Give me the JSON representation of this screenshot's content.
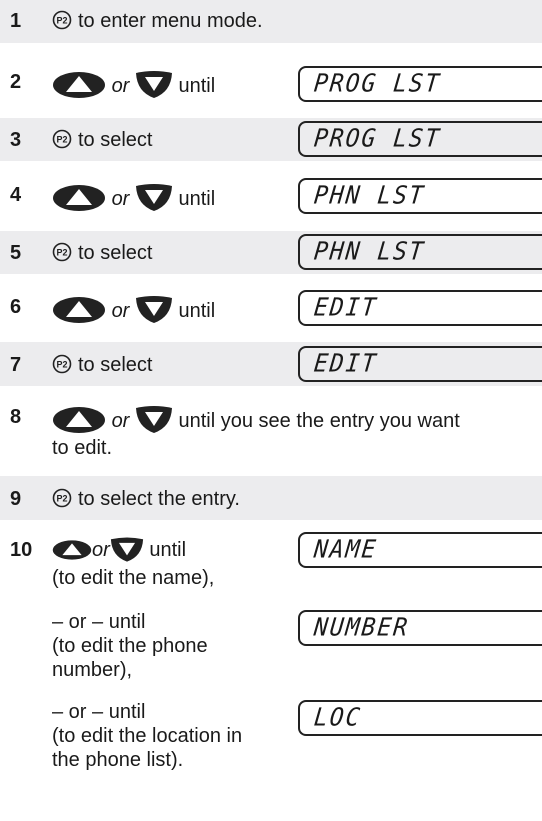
{
  "steps": [
    {
      "num": "1",
      "icons": [
        "p2"
      ],
      "before": "",
      "after": "to enter menu mode.",
      "lcd": ""
    },
    {
      "num": "2",
      "text_mid": "or",
      "after": "until",
      "lcd": "PROG LST"
    },
    {
      "num": "3",
      "after": "to select",
      "lcd": "PROG LST"
    },
    {
      "num": "4",
      "text_mid": "or",
      "after": "until",
      "lcd": "PHN LST"
    },
    {
      "num": "5",
      "after": "to select",
      "lcd": "PHN LST"
    },
    {
      "num": "6",
      "text_mid": "or",
      "after": "until",
      "lcd": "EDIT"
    },
    {
      "num": "7",
      "after": "to select",
      "lcd": "EDIT"
    },
    {
      "num": "8",
      "text_mid": "or",
      "after_line1": "until you see the entry you want",
      "after_line2": "to edit."
    },
    {
      "num": "9",
      "after": "to select the entry."
    },
    {
      "num": "10",
      "text_mid": "or",
      "after": "until",
      "line2": "(to edit the name),",
      "lcd": "NAME",
      "alt1_line1": "– or – until",
      "alt1_line2": "(to edit the phone",
      "alt1_line3": "number),",
      "alt1_lcd": "NUMBER",
      "alt2_line1": "– or –  until",
      "alt2_line2": "(to edit the location in",
      "alt2_line3": "the phone list).",
      "alt2_lcd": "LOC"
    }
  ],
  "colors": {
    "shade": "#ececee",
    "text": "#1a1a1a",
    "button": "#222222"
  },
  "icons": {
    "p2": "p2-button-icon",
    "up": "up-arrow-button-icon",
    "down": "down-arrow-button-icon"
  }
}
